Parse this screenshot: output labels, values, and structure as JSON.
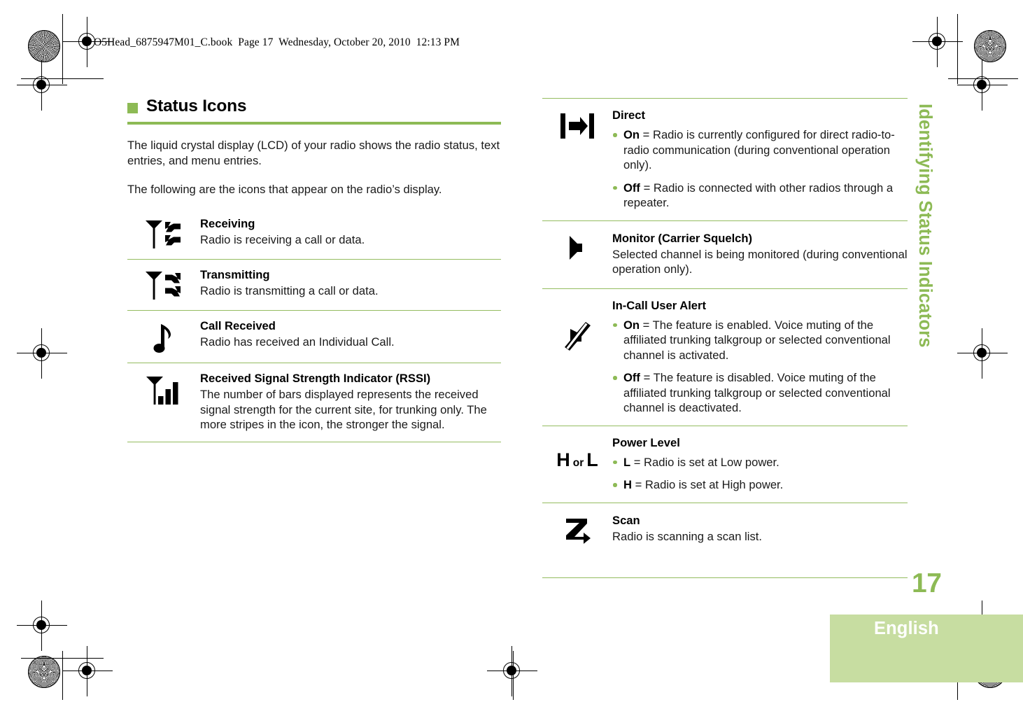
{
  "header": {
    "slug": "O5Head_6875947M01_C.book  Page 17  Wednesday, October 20, 2010  12:13 PM"
  },
  "side_tab": {
    "title": "Identifying Status Indicators"
  },
  "footer": {
    "page_number": "17",
    "language": "English"
  },
  "colors": {
    "accent_green": "#8DBA55",
    "rule_green": "#94BC60",
    "language_block": "#C7DDA1",
    "text": "#000000"
  },
  "section": {
    "heading": "Status Icons",
    "intro_paragraph_1": "The liquid crystal display (LCD) of your radio shows the radio status, text entries, and menu entries.",
    "intro_paragraph_2": "The following are the icons that appear on the radio’s display."
  },
  "left_column": {
    "rows": [
      {
        "icon": "antenna-receive-icon",
        "title": "Receiving",
        "description": "Radio is receiving a call or data."
      },
      {
        "icon": "antenna-transmit-icon",
        "title": "Transmitting",
        "description": "Radio is transmitting a call or data."
      },
      {
        "icon": "music-note-icon",
        "title": "Call Received",
        "description": "Radio has received an Individual Call."
      },
      {
        "icon": "signal-bars-icon",
        "title": "Received Signal Strength Indicator (RSSI)",
        "description": "The number of bars displayed represents the received signal strength for the current site, for trunking only. The more stripes in the icon, the stronger the signal."
      }
    ]
  },
  "right_column": {
    "rows": [
      {
        "icon": "direct-arrow-icon",
        "title": "Direct",
        "bullets": [
          {
            "term": "On",
            "text": " = Radio is currently configured for direct radio-to-radio communication (during conventional operation only)."
          },
          {
            "term": "Off",
            "text": " = Radio is connected with other radios through a repeater."
          }
        ]
      },
      {
        "icon": "monitor-speaker-icon",
        "title": "Monitor (Carrier Squelch)",
        "description": "Selected channel is being monitored (during conventional operation only)."
      },
      {
        "icon": "muted-speaker-icon",
        "title": "In-Call User Alert",
        "bullets": [
          {
            "term": "On",
            "text": " = The feature is enabled. Voice muting of the affiliated trunking talkgroup or selected conventional channel is activated."
          },
          {
            "term": "Off",
            "text": " = The feature is disabled. Voice muting of the affiliated trunking talkgroup or selected conventional channel is deactivated."
          }
        ]
      },
      {
        "icon": "power-level-h-or-l-icon",
        "icon_letters": {
          "high": "H",
          "conjunction": "or",
          "low": "L"
        },
        "title": "Power Level",
        "bullets": [
          {
            "term": "L",
            "text": " = Radio is set at Low power."
          },
          {
            "term": "H",
            "text": " = Radio is set at High power."
          }
        ]
      },
      {
        "icon": "scan-z-icon",
        "title": "Scan",
        "description": "Radio is scanning a scan list."
      }
    ]
  }
}
